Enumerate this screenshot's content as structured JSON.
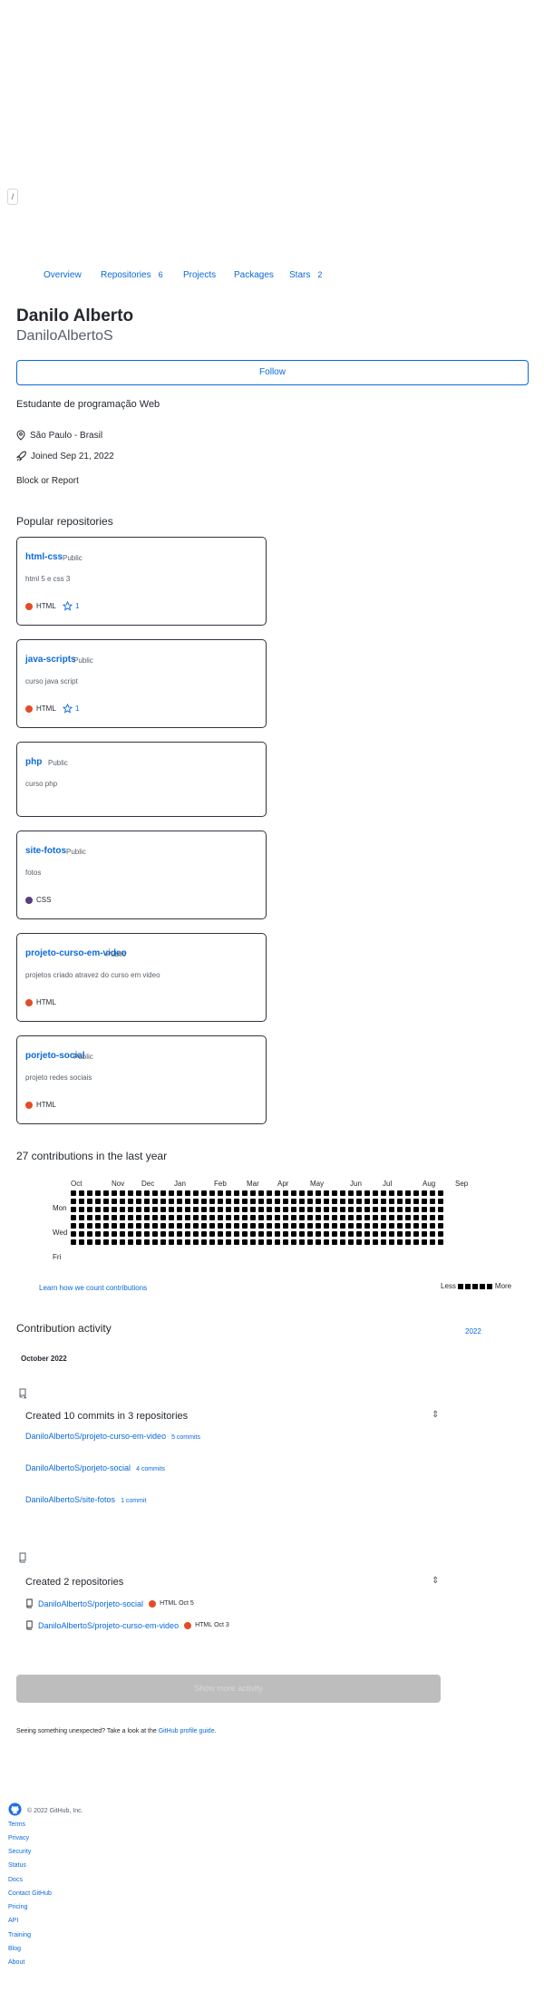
{
  "tiny_control": {
    "label": "/"
  },
  "tabs": [
    {
      "label": "Overview",
      "count": ""
    },
    {
      "label": "Repositories",
      "count": "6"
    },
    {
      "label": "Projects",
      "count": ""
    },
    {
      "label": "Packages",
      "count": ""
    },
    {
      "label": "Stars",
      "count": "2"
    }
  ],
  "profile": {
    "name": "Danilo Alberto",
    "login": "DaniloAlbertoS",
    "follow_label": "Follow",
    "bio": "Estudante de programação Web",
    "location": "São Paulo - Brasil",
    "joined": "Joined Sep 21, 2022",
    "block_label": "Block or Report"
  },
  "popular": {
    "title": "Popular repositories",
    "repos": [
      {
        "name": "html-css",
        "visibility": "Public",
        "description": "html 5 e css 3",
        "language": "HTML",
        "language_color": "#e34c26",
        "stars": "1"
      },
      {
        "name": "java-scripts",
        "visibility": "Public",
        "description": "curso java script",
        "language": "HTML",
        "language_color": "#e34c26",
        "stars": "1"
      },
      {
        "name": "php",
        "visibility": "Public",
        "description": "curso php",
        "language": "",
        "language_color": "",
        "stars": ""
      },
      {
        "name": "site-fotos",
        "visibility": "Public",
        "description": "fotos",
        "language": "CSS",
        "language_color": "#563d7c",
        "stars": ""
      },
      {
        "name": "projeto-curso-em-video",
        "visibility": "Public",
        "description": "projetos criado atravez do curso em video",
        "language": "HTML",
        "language_color": "#e34c26",
        "stars": ""
      },
      {
        "name": "porjeto-social",
        "visibility": "Public",
        "description": "projeto redes sociais",
        "language": "HTML",
        "language_color": "#e34c26",
        "stars": ""
      }
    ]
  },
  "contributions": {
    "title": "27 contributions in the last year",
    "months": [
      "Oct",
      "Nov",
      "Dec",
      "Jan",
      "Feb",
      "Mar",
      "Apr",
      "May",
      "Jun",
      "Jul",
      "Aug",
      "Sep"
    ],
    "days": [
      "Mon",
      "Wed",
      "Fri"
    ],
    "learn_label": "Learn how we count contributions",
    "less_label": "Less",
    "more_label": "More",
    "cell_color": "#000000"
  },
  "activity": {
    "title": "Contribution activity",
    "year": "2022",
    "month_label": "October 2022",
    "commits_heading": "Created 10 commits in 3 repositories",
    "commit_repos": [
      {
        "name": "DaniloAlbertoS/projeto-curso-em-video",
        "count": "5 commits"
      },
      {
        "name": "DaniloAlbertoS/porjeto-social",
        "count": "4 commits"
      },
      {
        "name": "DaniloAlbertoS/site-fotos",
        "count": "1 commit"
      }
    ],
    "repos_heading": "Created 2 repositories",
    "created_repos": [
      {
        "name": "DaniloAlbertoS/porjeto-social",
        "language": "HTML",
        "date": "Oct 5"
      },
      {
        "name": "DaniloAlbertoS/projeto-curso-em-video",
        "language": "HTML",
        "date": "Oct 3"
      }
    ],
    "show_more_label": "Show more activity",
    "unexpected_text": "Seeing something unexpected? Take a look at the",
    "guide_link": "GitHub profile guide",
    "unexpected_end": "."
  },
  "footer": {
    "copyright": "© 2022 GitHub, Inc.",
    "links": [
      "Terms",
      "Privacy",
      "Security",
      "Status",
      "Docs",
      "Contact GitHub",
      "Pricing",
      "API",
      "Training",
      "Blog",
      "About"
    ]
  },
  "colors": {
    "link": "#0969da",
    "html": "#e34c26",
    "css": "#563d7c",
    "text": "#24292f",
    "muted": "#57606a"
  }
}
